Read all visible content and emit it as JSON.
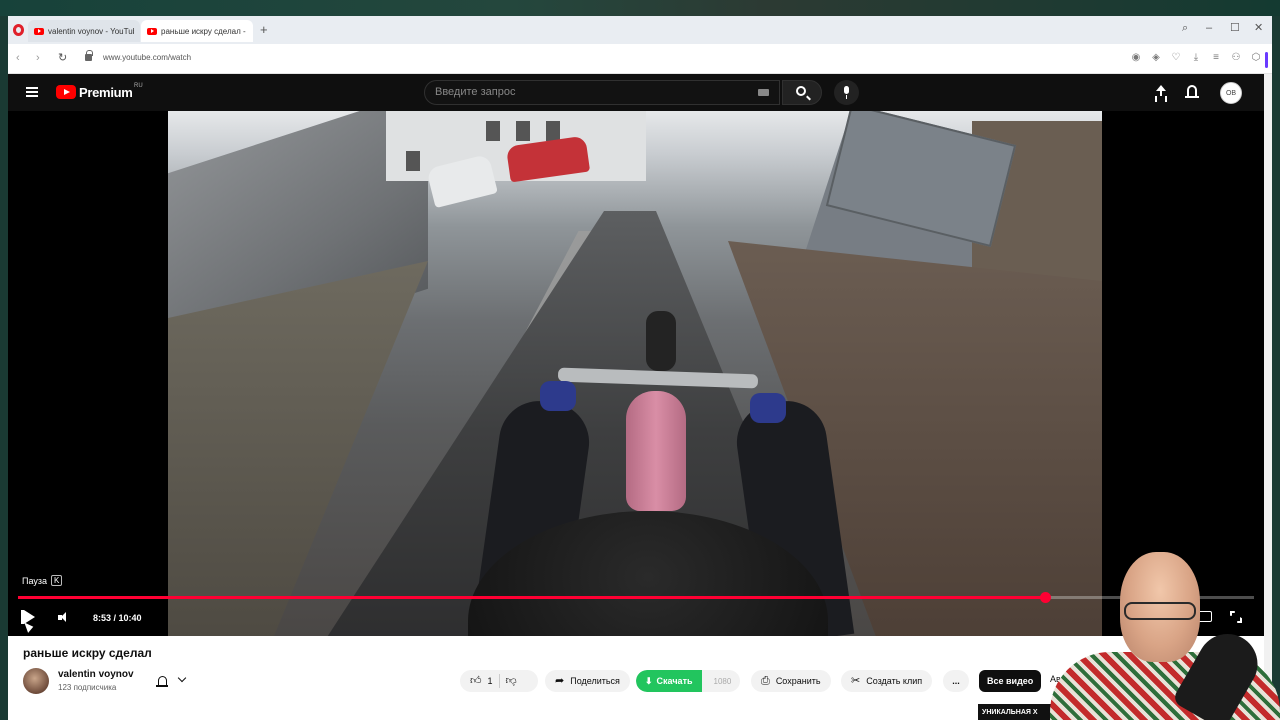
{
  "browser": {
    "tabs": [
      {
        "title": "valentin voynov - YouTube"
      },
      {
        "title": "раньше искру сделал - YouTube"
      }
    ],
    "url": "www.youtube.com/watch"
  },
  "header": {
    "brand": "Premium",
    "region": "RU",
    "search_placeholder": "Введите запрос",
    "account_initials": "OB"
  },
  "player": {
    "tooltip": "Пауза",
    "tooltip_key": "K",
    "time": "8:53 / 10:40",
    "progress": 0.831
  },
  "video": {
    "title": "раньше искру сделал",
    "channel": "valentin voynov",
    "subscribers": "123 подписчика",
    "likes": "1",
    "share_label": "Поделиться",
    "download_label": "Скачать",
    "download_quality": "1080",
    "save_label": "Сохранить",
    "clip_label": "Создать клип",
    "more_label": "...",
    "chip_all": "Все видео",
    "chip_next": "Ав",
    "rec_thumb_text": "УНИКАЛЬНАЯ Х"
  }
}
